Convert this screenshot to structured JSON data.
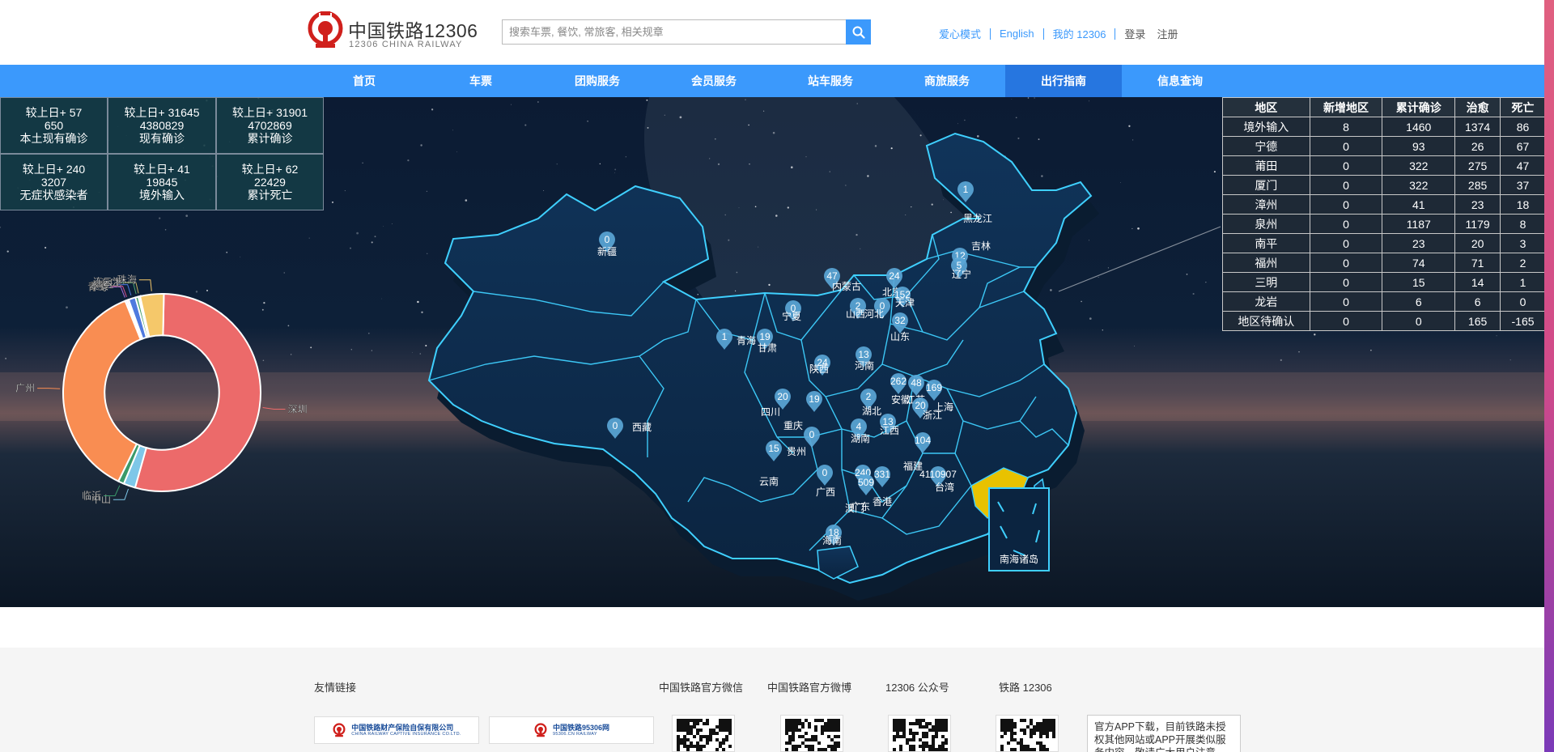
{
  "header": {
    "logo_title": "中国铁路12306",
    "logo_subtitle": "12306 CHINA RAILWAY",
    "search_placeholder": "搜索车票, 餐饮, 常旅客, 相关规章",
    "links": [
      "爱心模式",
      "English",
      "我的 12306"
    ],
    "login": "登录",
    "register": "注册"
  },
  "nav": {
    "items": [
      "首页",
      "车票",
      "团购服务",
      "会员服务",
      "站车服务",
      "商旅服务",
      "出行指南",
      "信息查询"
    ],
    "active_index": 6
  },
  "stats": [
    {
      "line1": "较上日+ 57",
      "line2": "650",
      "label": "本土现有确诊"
    },
    {
      "line1": "较上日+ 31645",
      "line2": "4380829",
      "label": "现有确诊"
    },
    {
      "line1": "较上日+ 31901",
      "line2": "4702869",
      "label": "累计确诊"
    },
    {
      "line1": "较上日+ 240",
      "line2": "3207",
      "label": "无症状感染者"
    },
    {
      "line1": "较上日+ 41",
      "line2": "19845",
      "label": "境外输入"
    },
    {
      "line1": "较上日+ 62",
      "line2": "22429",
      "label": "累计死亡"
    }
  ],
  "chart_data": {
    "type": "pie",
    "labels": [
      "深圳",
      "中山",
      "临沂",
      "广州",
      "青岛",
      "泰安",
      "商丘",
      "海口",
      "连云港",
      "珠海"
    ],
    "values": [
      56,
      2,
      1,
      38,
      0.3,
      0.3,
      1.2,
      0.5,
      0.3,
      4
    ],
    "colors": [
      "#ec6a6a",
      "#7ec7e8",
      "#3a9a6a",
      "#f98d52",
      "#a36bd4",
      "#d94f8a",
      "#4f7adf",
      "#4aa36e",
      "#c7b15a",
      "#f5c86a"
    ],
    "title": "",
    "inner_radius_ratio": 0.58
  },
  "map": {
    "provinces": [
      {
        "name": "新疆",
        "count": "0"
      },
      {
        "name": "西藏",
        "count": "0"
      },
      {
        "name": "青海",
        "count": "1"
      },
      {
        "name": "甘肃",
        "count": "19"
      },
      {
        "name": "宁夏",
        "count": "0"
      },
      {
        "name": "内蒙古",
        "count": "47"
      },
      {
        "name": "黑龙江",
        "count": "1"
      },
      {
        "name": "吉林",
        "count": "12"
      },
      {
        "name": "辽宁",
        "count": "5"
      },
      {
        "name": "北京",
        "count": "24"
      },
      {
        "name": "天津",
        "count": "152"
      },
      {
        "name": "河北",
        "count": "0"
      },
      {
        "name": "山西",
        "count": "2"
      },
      {
        "name": "山东",
        "count": "32"
      },
      {
        "name": "陕西",
        "count": "24"
      },
      {
        "name": "河南",
        "count": "13"
      },
      {
        "name": "四川",
        "count": "20"
      },
      {
        "name": "重庆",
        "count": "19"
      },
      {
        "name": "湖北",
        "count": "2"
      },
      {
        "name": "安徽",
        "count": "262"
      },
      {
        "name": "江苏",
        "count": "48"
      },
      {
        "name": "上海",
        "count": "169"
      },
      {
        "name": "浙江",
        "count": "20"
      },
      {
        "name": "湖南",
        "count": "4"
      },
      {
        "name": "江西",
        "count": "13"
      },
      {
        "name": "贵州",
        "count": "0"
      },
      {
        "name": "云南",
        "count": "15"
      },
      {
        "name": "广西",
        "count": "0"
      },
      {
        "name": "广东",
        "count": "240"
      },
      {
        "name": "香港",
        "count": "331"
      },
      {
        "name": "澳门",
        "count": "509"
      },
      {
        "name": "海南",
        "count": "18"
      },
      {
        "name": "福建",
        "count": "104"
      },
      {
        "name": "台湾",
        "count": "4110907"
      }
    ],
    "inset_label": "南海诸岛",
    "highlight_color": "#e8c200"
  },
  "table": {
    "headers": [
      "地区",
      "新增地区",
      "累计确诊",
      "治愈",
      "死亡"
    ],
    "rows": [
      [
        "境外输入",
        "8",
        "1460",
        "1374",
        "86"
      ],
      [
        "宁德",
        "0",
        "93",
        "26",
        "67"
      ],
      [
        "莆田",
        "0",
        "322",
        "275",
        "47"
      ],
      [
        "厦门",
        "0",
        "322",
        "285",
        "37"
      ],
      [
        "漳州",
        "0",
        "41",
        "23",
        "18"
      ],
      [
        "泉州",
        "0",
        "1187",
        "1179",
        "8"
      ],
      [
        "南平",
        "0",
        "23",
        "20",
        "3"
      ],
      [
        "福州",
        "0",
        "74",
        "71",
        "2"
      ],
      [
        "三明",
        "0",
        "15",
        "14",
        "1"
      ],
      [
        "龙岩",
        "0",
        "6",
        "6",
        "0"
      ],
      [
        "地区待确认",
        "0",
        "0",
        "165",
        "-165"
      ]
    ]
  },
  "footer": {
    "friend_links_label": "友情链接",
    "partner1_title": "中国铁路财产保险自保有限公司",
    "partner1_sub": "CHINA RAILWAY CAPTIVE INSURANCE CO.LTD.",
    "partner2_title": "中国铁路95306网",
    "partner2_sub": "95306.CN RAILWAY",
    "qr_labels": [
      "中国铁路官方微信",
      "中国铁路官方微博",
      "12306 公众号",
      "铁路 12306"
    ],
    "app_note": "官方APP下载，目前铁路未授权其他网站或APP开展类似服务内容，敬请广大用户注意。"
  }
}
